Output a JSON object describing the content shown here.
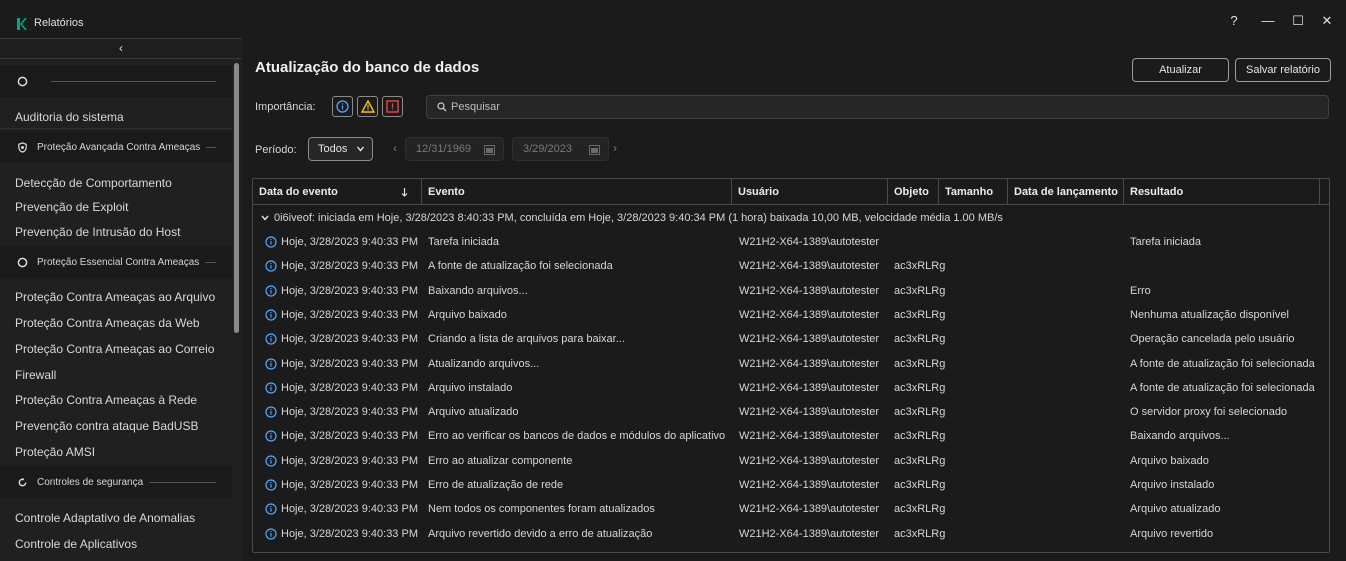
{
  "window": {
    "title": "Relatórios",
    "help": "?",
    "minimize": "—",
    "maximize": "☐",
    "close": "✕"
  },
  "sidebar": {
    "collapse": "‹",
    "groups": [
      {
        "label": "",
        "icon": "circle-outline-icon"
      },
      {
        "label": "Proteção Avançada Contra Ameaças",
        "icon": "shield-icon"
      },
      {
        "label": "Proteção Essencial Contra Ameaças",
        "icon": "circle-outline-icon"
      },
      {
        "label": "Controles de segurança",
        "icon": "refresh-circle-icon"
      }
    ],
    "items": [
      "Auditoria do sistema",
      "Detecção de Comportamento",
      "Prevenção de Exploit",
      "Prevenção de Intrusão do Host",
      "Proteção Contra Ameaças ao Arquivo",
      "Proteção Contra Ameaças da Web",
      "Proteção Contra Ameaças ao Correio",
      "Firewall",
      "Proteção Contra Ameaças à Rede",
      "Prevenção contra ataque BadUSB",
      "Proteção AMSI",
      "Controle Adaptativo de Anomalias",
      "Controle de Aplicativos"
    ]
  },
  "main": {
    "title": "Atualização do banco de dados",
    "update_button": "Atualizar",
    "save_button": "Salvar relatório",
    "importance_label": "Importância:",
    "search_placeholder": "Pesquisar",
    "period_label": "Período:",
    "period_value": "Todos",
    "date_from": "12/31/1969",
    "date_to": "3/29/2023",
    "prev_arrow": "‹",
    "next_arrow": "›"
  },
  "table": {
    "columns": [
      "Data do evento",
      "Evento",
      "Usuário",
      "Objeto",
      "Tamanho",
      "Data de lançamento",
      "Resultado"
    ],
    "group_text": "0i6iveof: iniciada em Hoje, 3/28/2023 8:40:33 PM, concluída em Hoje, 3/28/2023 9:40:34 PM (1 hora) baixada 10,00 MB, velocidade média 1.00 MB/s",
    "rows": [
      {
        "date": "Hoje, 3/28/2023 9:40:33 PM",
        "event": "Tarefa iniciada",
        "user": "W21H2-X64-1389\\autotester",
        "object": "",
        "result": "Tarefa iniciada"
      },
      {
        "date": "Hoje, 3/28/2023 9:40:33 PM",
        "event": "A fonte de atualização foi selecionada",
        "user": "W21H2-X64-1389\\autotester",
        "object": "ac3xRLRg",
        "result": ""
      },
      {
        "date": "Hoje, 3/28/2023 9:40:33 PM",
        "event": "Baixando arquivos...",
        "user": "W21H2-X64-1389\\autotester",
        "object": "ac3xRLRg",
        "result": "Erro"
      },
      {
        "date": "Hoje, 3/28/2023 9:40:33 PM",
        "event": "Arquivo baixado",
        "user": "W21H2-X64-1389\\autotester",
        "object": "ac3xRLRg",
        "result": "Nenhuma atualização disponível"
      },
      {
        "date": "Hoje, 3/28/2023 9:40:33 PM",
        "event": "Criando a lista de arquivos para baixar...",
        "user": "W21H2-X64-1389\\autotester",
        "object": "ac3xRLRg",
        "result": "Operação cancelada pelo usuário"
      },
      {
        "date": "Hoje, 3/28/2023 9:40:33 PM",
        "event": "Atualizando arquivos...",
        "user": "W21H2-X64-1389\\autotester",
        "object": "ac3xRLRg",
        "result": "A fonte de atualização foi selecionada"
      },
      {
        "date": "Hoje, 3/28/2023 9:40:33 PM",
        "event": "Arquivo instalado",
        "user": "W21H2-X64-1389\\autotester",
        "object": "ac3xRLRg",
        "result": "A fonte de atualização foi selecionada"
      },
      {
        "date": "Hoje, 3/28/2023 9:40:33 PM",
        "event": "Arquivo atualizado",
        "user": "W21H2-X64-1389\\autotester",
        "object": "ac3xRLRg",
        "result": "O servidor proxy foi selecionado"
      },
      {
        "date": "Hoje, 3/28/2023 9:40:33 PM",
        "event": "Erro ao verificar os bancos de dados e módulos do aplicativo",
        "user": "W21H2-X64-1389\\autotester",
        "object": "ac3xRLRg",
        "result": "Baixando arquivos..."
      },
      {
        "date": "Hoje, 3/28/2023 9:40:33 PM",
        "event": "Erro ao atualizar componente",
        "user": "W21H2-X64-1389\\autotester",
        "object": "ac3xRLRg",
        "result": "Arquivo baixado"
      },
      {
        "date": "Hoje, 3/28/2023 9:40:33 PM",
        "event": "Erro de atualização de rede",
        "user": "W21H2-X64-1389\\autotester",
        "object": "ac3xRLRg",
        "result": "Arquivo instalado"
      },
      {
        "date": "Hoje, 3/28/2023 9:40:33 PM",
        "event": "Nem todos os componentes foram atualizados",
        "user": "W21H2-X64-1389\\autotester",
        "object": "ac3xRLRg",
        "result": "Arquivo atualizado"
      },
      {
        "date": "Hoje, 3/28/2023 9:40:33 PM",
        "event": "Arquivo revertido devido a erro de atualização",
        "user": "W21H2-X64-1389\\autotester",
        "object": "ac3xRLRg",
        "result": "Arquivo revertido"
      }
    ]
  },
  "colors": {
    "accent": "#4fa8ff",
    "warning": "#f5c518",
    "error": "#e5484d",
    "logo": "#00a88e"
  }
}
